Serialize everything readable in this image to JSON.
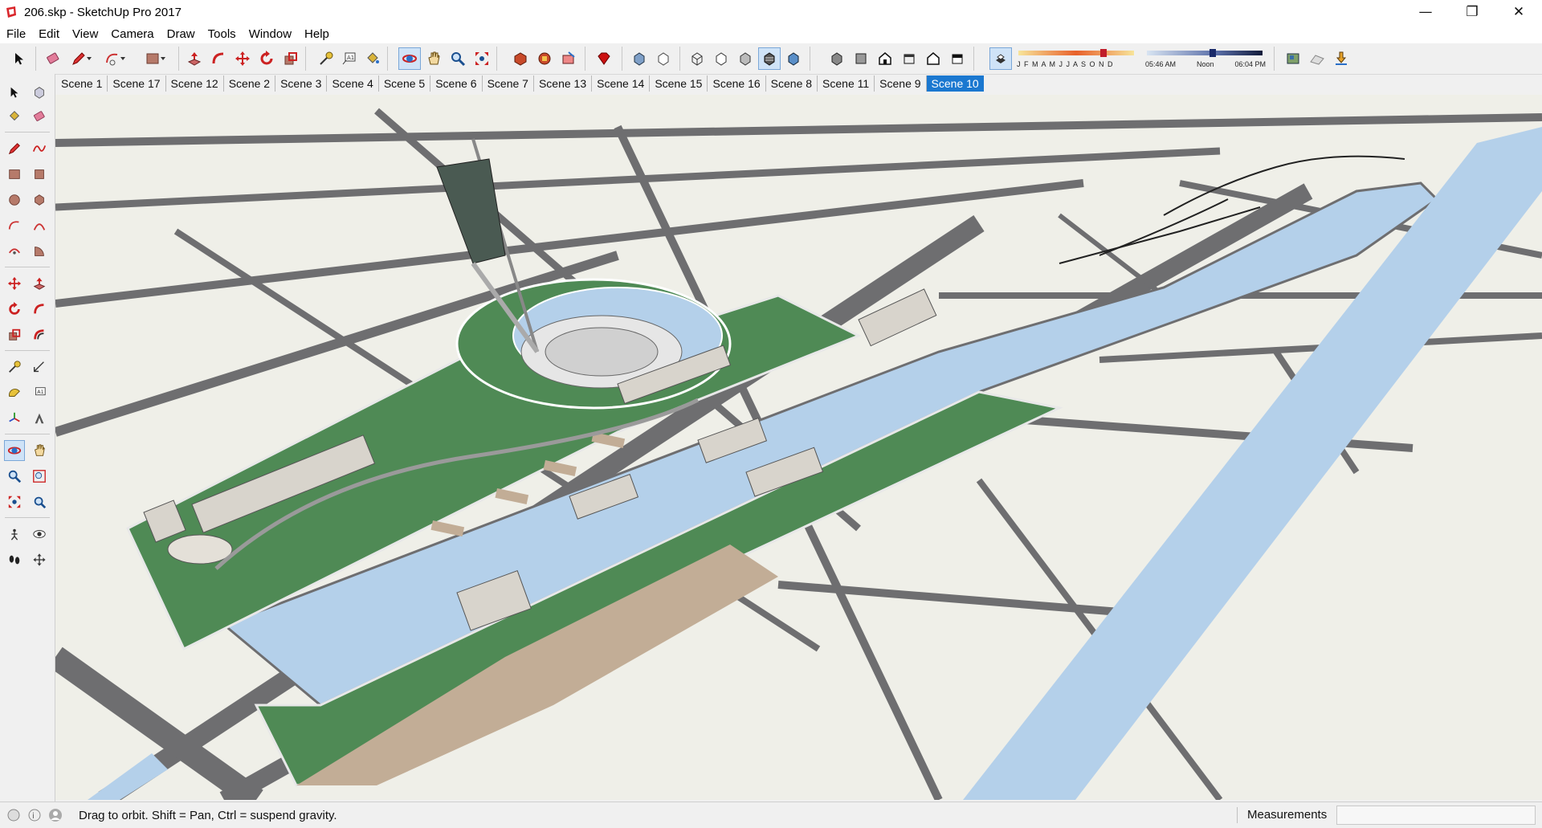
{
  "window": {
    "title": "206.skp - SketchUp Pro 2017",
    "controls": {
      "minimize": "—",
      "restore": "❐",
      "close": "✕"
    }
  },
  "menu": [
    "File",
    "Edit",
    "View",
    "Camera",
    "Draw",
    "Tools",
    "Window",
    "Help"
  ],
  "shadow_settings": {
    "months": "J F M A M J J A S O N D",
    "time_start": "05:46 AM",
    "time_mid": "Noon",
    "time_end": "06:04 PM"
  },
  "scenes": {
    "tabs": [
      "Scene 1",
      "Scene 17",
      "Scene 12",
      "Scene 2",
      "Scene 3",
      "Scene 4",
      "Scene 5",
      "Scene 6",
      "Scene 7",
      "Scene 13",
      "Scene 14",
      "Scene 15",
      "Scene 16",
      "Scene 8",
      "Scene 11",
      "Scene 9",
      "Scene 10"
    ],
    "active": "Scene 10"
  },
  "statusbar": {
    "hint": "Drag to orbit. Shift = Pan, Ctrl = suspend gravity.",
    "measurements_label": "Measurements",
    "measurements_value": ""
  },
  "colors": {
    "accent": "#1b78d0",
    "road": "#6e6e70",
    "block": "#efefe8",
    "water": "#b4d0ea",
    "grass": "#4f8a55",
    "sand": "#c2ad96"
  }
}
